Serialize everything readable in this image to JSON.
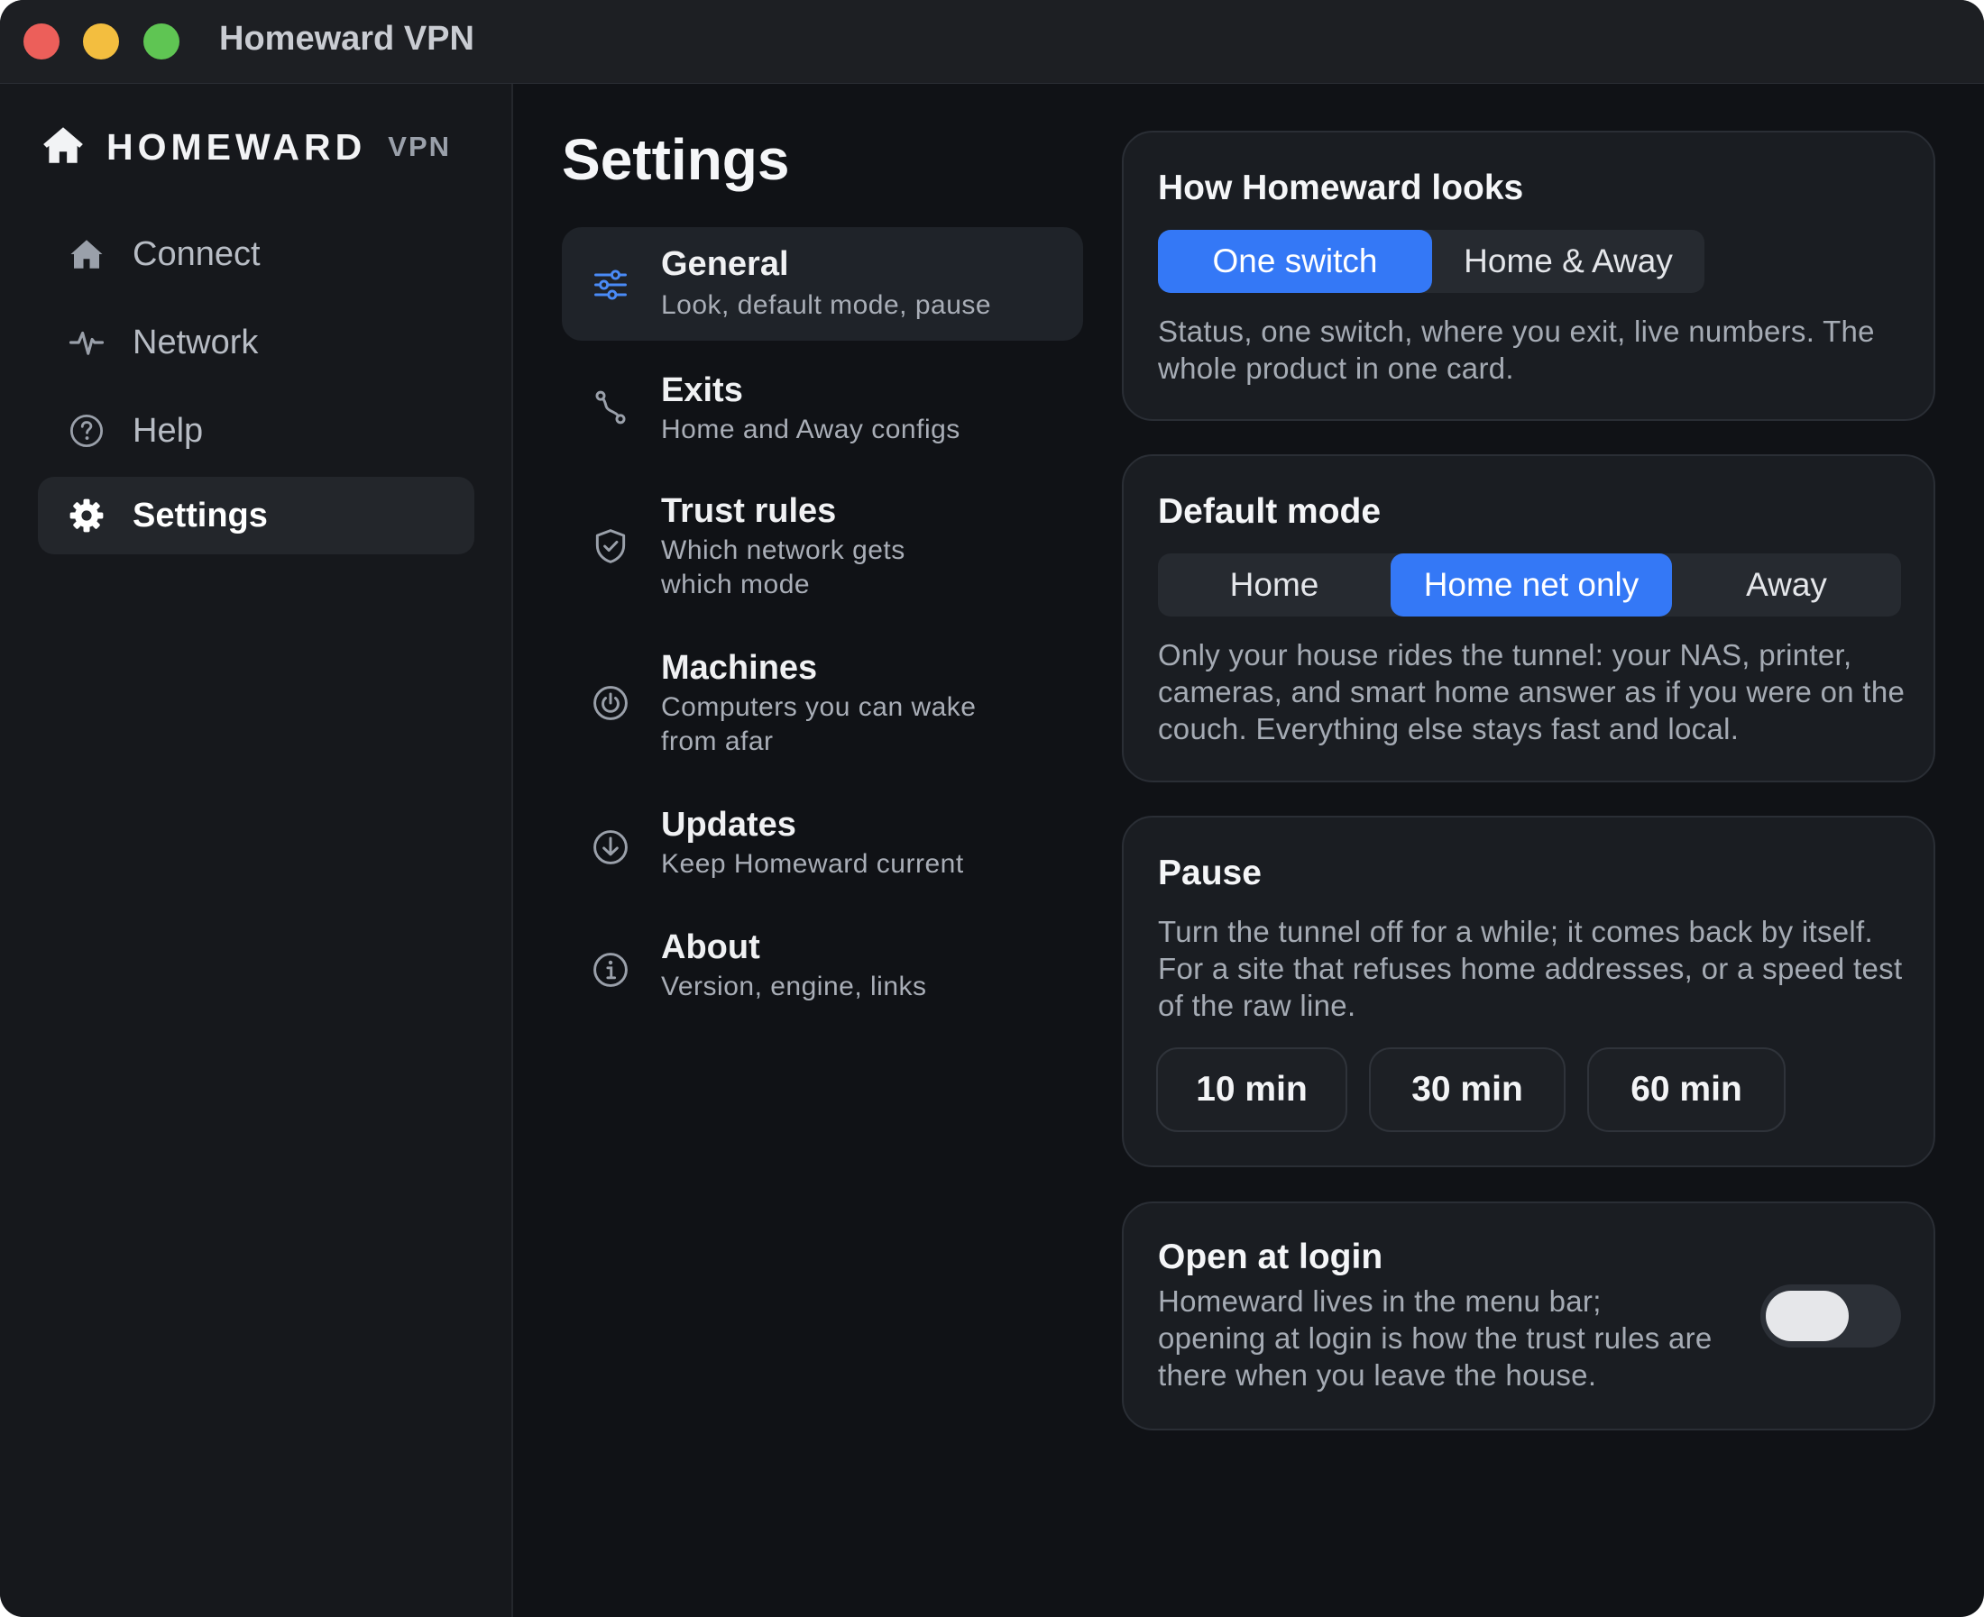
{
  "window": {
    "title": "Homeward VPN"
  },
  "brand": {
    "name": "HOMEWARD",
    "tag": "VPN"
  },
  "nav": [
    {
      "label": "Connect",
      "icon": "house-icon",
      "active": false
    },
    {
      "label": "Network",
      "icon": "pulse-icon",
      "active": false
    },
    {
      "label": "Help",
      "icon": "question-circle-icon",
      "active": false
    },
    {
      "label": "Settings",
      "icon": "gear-icon",
      "active": true
    }
  ],
  "settings": {
    "title": "Settings",
    "sections": [
      {
        "title": "General",
        "desc": "Look, default mode, pause",
        "icon": "sliders-icon",
        "active": true
      },
      {
        "title": "Exits",
        "desc": "Home and Away configs",
        "icon": "route-icon",
        "active": false
      },
      {
        "title": "Trust rules",
        "desc": "Which network gets which mode",
        "icon": "shield-check-icon",
        "active": false
      },
      {
        "title": "Machines",
        "desc": "Computers you can wake from afar",
        "icon": "power-icon",
        "active": false
      },
      {
        "title": "Updates",
        "desc": "Keep Homeward current",
        "icon": "download-circle-icon",
        "active": false
      },
      {
        "title": "About",
        "desc": "Version, engine, links",
        "icon": "info-circle-icon",
        "active": false
      }
    ]
  },
  "look": {
    "title": "How Homeward looks",
    "options": [
      "One switch",
      "Home & Away"
    ],
    "selected": "One switch",
    "desc": "Status, one switch, where you exit, live numbers. The whole product in one card."
  },
  "mode": {
    "title": "Default mode",
    "options": [
      "Home",
      "Home net only",
      "Away"
    ],
    "selected": "Home net only",
    "desc": "Only your house rides the tunnel: your NAS, printer, cameras, and smart home answer as if you were on the couch. Everything else stays fast and local."
  },
  "pause": {
    "title": "Pause",
    "desc": "Turn the tunnel off for a while; it comes back by itself. For a site that refuses home addresses, or a speed test of the raw line.",
    "options": [
      "10 min",
      "30 min",
      "60 min"
    ]
  },
  "login": {
    "title": "Open at login",
    "desc": "Homeward lives in the menu bar; opening at login is how the trust rules are there when you leave the house.",
    "enabled": false
  },
  "colors": {
    "accent": "#3478f6",
    "background": "#101216",
    "sidebar": "#16181c",
    "card": "#1a1d22"
  }
}
